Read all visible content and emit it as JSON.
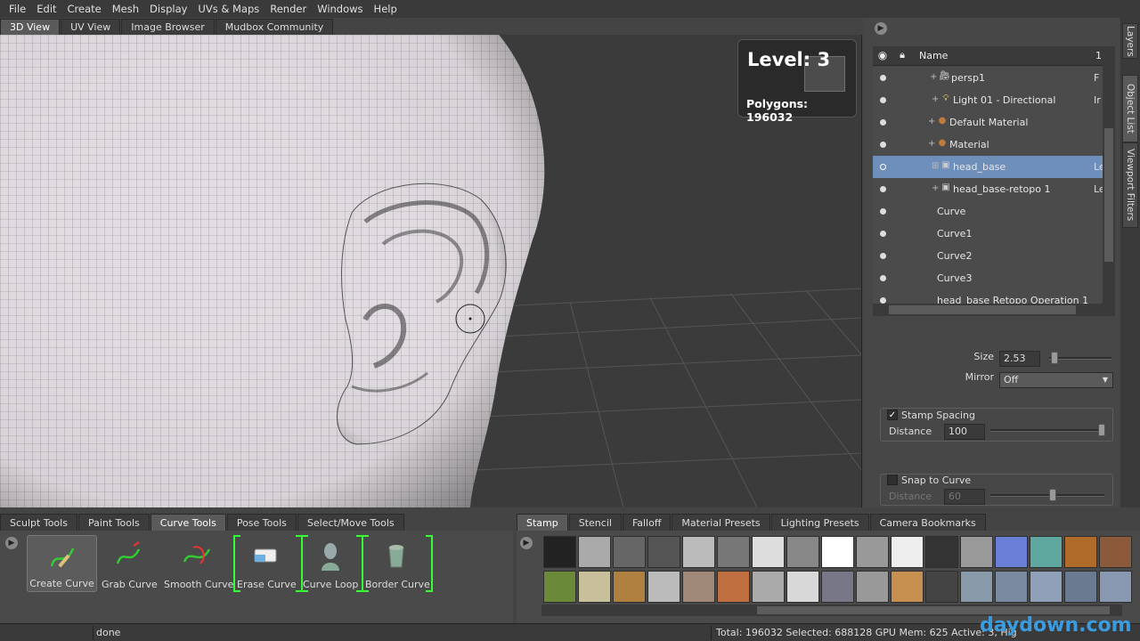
{
  "menu": [
    "File",
    "Edit",
    "Create",
    "Mesh",
    "Display",
    "UVs & Maps",
    "Render",
    "Windows",
    "Help"
  ],
  "viewport_tabs": [
    {
      "label": "3D View",
      "active": true
    },
    {
      "label": "UV View",
      "active": false
    },
    {
      "label": "Image Browser",
      "active": false
    },
    {
      "label": "Mudbox Community",
      "active": false
    }
  ],
  "hud": {
    "level": "Level: 3",
    "polygons": "Polygons: 196032"
  },
  "side_tabs": [
    "Layers",
    "Object List",
    "Viewport Filters"
  ],
  "object_list": {
    "header": {
      "name": "Name",
      "col2": "1"
    },
    "rows": [
      {
        "label": "persp1",
        "icon": "camera-icon",
        "trailing": "F",
        "selected": false
      },
      {
        "label": "Light 01 - Directional",
        "icon": "light-icon",
        "trailing": "Ir",
        "selected": false
      },
      {
        "label": "Default Material",
        "icon": "material-icon",
        "trailing": "",
        "selected": false
      },
      {
        "label": "Material",
        "icon": "material-icon",
        "trailing": "",
        "selected": false
      },
      {
        "label": "head_base",
        "icon": "mesh-icon",
        "trailing": "Le",
        "selected": true
      },
      {
        "label": "head_base-retopo 1",
        "icon": "mesh-icon",
        "trailing": "Le",
        "selected": false
      },
      {
        "label": "Curve",
        "icon": "",
        "trailing": "",
        "selected": false
      },
      {
        "label": "Curve1",
        "icon": "",
        "trailing": "",
        "selected": false
      },
      {
        "label": "Curve2",
        "icon": "",
        "trailing": "",
        "selected": false
      },
      {
        "label": "Curve3",
        "icon": "",
        "trailing": "",
        "selected": false
      },
      {
        "label": "head_base Retopo Operation 1",
        "icon": "",
        "trailing": "",
        "selected": false
      }
    ]
  },
  "properties": {
    "size_label": "Size",
    "size_value": "2.53",
    "size_slider": 0.08,
    "mirror_label": "Mirror",
    "mirror_value": "Off",
    "stamp_spacing_label": "Stamp Spacing",
    "stamp_spacing_checked": true,
    "distance_label": "Distance",
    "distance_value": "100",
    "distance_slider": 0.98,
    "snap_label": "Snap to Curve",
    "snap_checked": false,
    "snap_distance_label": "Distance",
    "snap_distance_value": "60",
    "snap_distance_slider": 0.55
  },
  "shelf_tabs": [
    {
      "label": "Sculpt Tools",
      "active": false
    },
    {
      "label": "Paint Tools",
      "active": false
    },
    {
      "label": "Curve Tools",
      "active": true
    },
    {
      "label": "Pose Tools",
      "active": false
    },
    {
      "label": "Select/Move Tools",
      "active": false
    }
  ],
  "tools": [
    {
      "label": "Create Curve",
      "active": true
    },
    {
      "label": "Grab Curve",
      "active": false
    },
    {
      "label": "Smooth Curve",
      "active": false
    },
    {
      "label": "Erase Curve",
      "active": false
    },
    {
      "label": "Curve Loop",
      "active": false
    },
    {
      "label": "Border Curve",
      "active": false
    }
  ],
  "stamp_tabs": [
    {
      "label": "Stamp",
      "active": true
    },
    {
      "label": "Stencil",
      "active": false
    },
    {
      "label": "Falloff",
      "active": false
    },
    {
      "label": "Material Presets",
      "active": false
    },
    {
      "label": "Lighting Presets",
      "active": false
    },
    {
      "label": "Camera Bookmarks",
      "active": false
    }
  ],
  "stamp_thumbs_row1": [
    "#222",
    "#aaa",
    "#666",
    "#555",
    "#bbb",
    "#777",
    "#ddd",
    "#888",
    "#fff",
    "#999",
    "#eee",
    "#333",
    "#9a9a9a",
    "#6b7fd6",
    "#5fa8a0",
    "#b06a2a",
    "#8a5a3a"
  ],
  "stamp_thumbs_row2": [
    "#6a8a3a",
    "#c8c09a",
    "#b08040",
    "#bbbbbb",
    "#a08878",
    "#c07040",
    "#aaaaaa",
    "#d8d8d8",
    "#777788",
    "#999999",
    "#c89050",
    "#444444",
    "#8899aa",
    "#7a8aa0",
    "#8fa0b8",
    "#6a7a90",
    "#8898b0"
  ],
  "status": {
    "message": "done",
    "stats": "Total: 196032  Selected: 688128 GPU Mem: 625  Active: 3, Hig"
  },
  "watermark": "daydown.com"
}
